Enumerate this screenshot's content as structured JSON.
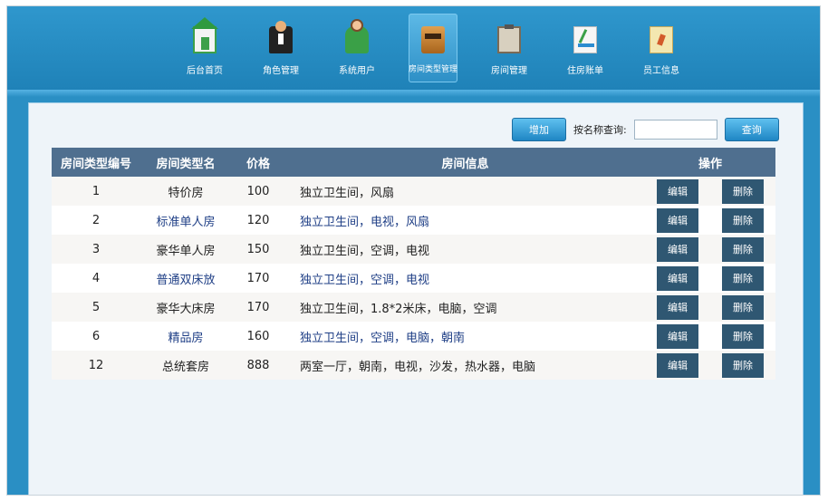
{
  "nav": {
    "items": [
      {
        "label": "后台首页",
        "icon": "home-icon"
      },
      {
        "label": "角色管理",
        "icon": "waiter-icon"
      },
      {
        "label": "系统用户",
        "icon": "user-icon"
      },
      {
        "label": "房间类型管理",
        "icon": "room-type-icon",
        "active": true
      },
      {
        "label": "房间管理",
        "icon": "clipboard-icon"
      },
      {
        "label": "住房账单",
        "icon": "bill-icon"
      },
      {
        "label": "员工信息",
        "icon": "staff-note-icon"
      }
    ]
  },
  "toolbar": {
    "add_label": "增加",
    "search_label": "按名称查询:",
    "search_value": "",
    "query_label": "查询"
  },
  "table": {
    "headers": {
      "id": "房间类型编号",
      "name": "房间类型名",
      "price": "价格",
      "info": "房间信息",
      "ops": "操作"
    },
    "edit_label": "编辑",
    "delete_label": "删除",
    "rows": [
      {
        "id": "1",
        "name": "特价房",
        "price": "100",
        "info": "独立卫生间，风扇"
      },
      {
        "id": "2",
        "name": "标准单人房",
        "price": "120",
        "info": "独立卫生间，电视，风扇"
      },
      {
        "id": "3",
        "name": "豪华单人房",
        "price": "150",
        "info": "独立卫生间，空调，电视"
      },
      {
        "id": "4",
        "name": "普通双床放",
        "price": "170",
        "info": "独立卫生间，空调，电视"
      },
      {
        "id": "5",
        "name": "豪华大床房",
        "price": "170",
        "info": "独立卫生间，1.8*2米床，电脑，空调"
      },
      {
        "id": "6",
        "name": "精品房",
        "price": "160",
        "info": "独立卫生间，空调，电脑，朝南"
      },
      {
        "id": "12",
        "name": "总统套房",
        "price": "888",
        "info": "两室一厅，朝南，电视，沙发，热水器，电脑"
      }
    ]
  }
}
